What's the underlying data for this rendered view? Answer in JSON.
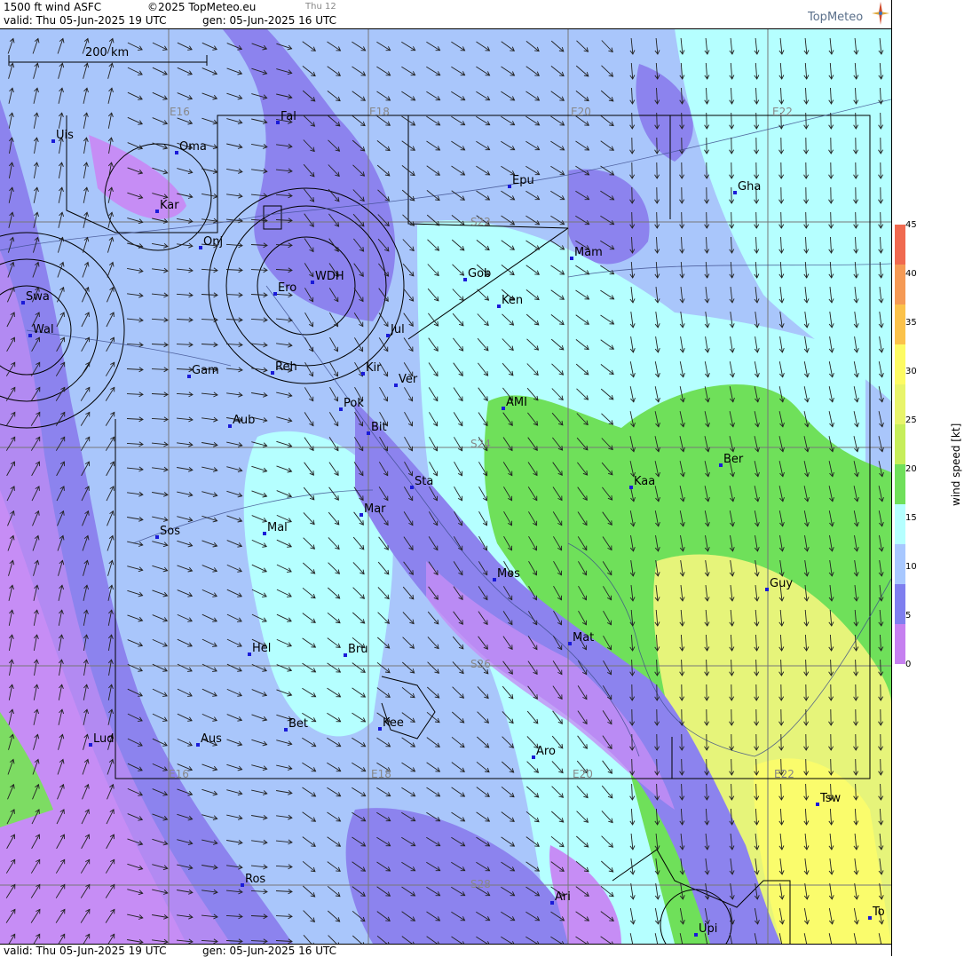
{
  "header": {
    "title": "1500 ft wind ASFC",
    "copyright": "©2025 TopMeteo.eu",
    "day_tab": "Thu 12",
    "valid": "valid:  Thu  05-Jun-2025  19 UTC",
    "generated": "gen:  05-Jun-2025 16 UTC",
    "logo": "TopMeteo"
  },
  "footer": {
    "valid": "valid:  Thu  05-Jun-2025  19 UTC",
    "generated": "gen:  05-Jun-2025 16 UTC"
  },
  "scale_bar": {
    "label": "200 km"
  },
  "legend": {
    "title": "wind  speed  [kt]",
    "ticks": [
      "45",
      "40",
      "35",
      "30",
      "25",
      "20",
      "15",
      "10",
      "5",
      "0"
    ],
    "colors": [
      "#f06a50",
      "#f59a55",
      "#fbc24a",
      "#fdfb63",
      "#e8f46a",
      "#c6ee5a",
      "#6fe05a",
      "#b5ffff",
      "#a8c8ff",
      "#7f7fef",
      "#c680f0"
    ]
  },
  "grid_labels": {
    "lon_top": [
      "E16",
      "E18",
      "E20",
      "E22"
    ],
    "lon_bottom": [
      "E16",
      "E18",
      "E20",
      "E22"
    ],
    "lat": [
      "S22",
      "S24",
      "S26",
      "S28"
    ]
  },
  "places": [
    {
      "name": "Uis",
      "label": "Uis"
    },
    {
      "name": "Oma",
      "label": "Oma"
    },
    {
      "name": "Fal",
      "label": "Fal"
    },
    {
      "name": "Kar",
      "label": "Kar"
    },
    {
      "name": "Onj",
      "label": "Onj"
    },
    {
      "name": "Epu",
      "label": "Epu"
    },
    {
      "name": "Gha",
      "label": "Gha"
    },
    {
      "name": "Mam",
      "label": "Mam"
    },
    {
      "name": "Gob",
      "label": "Gob"
    },
    {
      "name": "WDH",
      "label": "WDH"
    },
    {
      "name": "Ero",
      "label": "Ero"
    },
    {
      "name": "Ken",
      "label": "Ken"
    },
    {
      "name": "Swa",
      "label": "Swa"
    },
    {
      "name": "Wal",
      "label": "Wal"
    },
    {
      "name": "Jul",
      "label": "Jul"
    },
    {
      "name": "Gam",
      "label": "Gam"
    },
    {
      "name": "Reh",
      "label": "Reh"
    },
    {
      "name": "Kir",
      "label": "Kir"
    },
    {
      "name": "Ver",
      "label": "Ver"
    },
    {
      "name": "AMI",
      "label": "AMI"
    },
    {
      "name": "Pok",
      "label": "Pok"
    },
    {
      "name": "Aub",
      "label": "Aub"
    },
    {
      "name": "Bit",
      "label": "Bit"
    },
    {
      "name": "Ber",
      "label": "Ber"
    },
    {
      "name": "Sta",
      "label": "Sta"
    },
    {
      "name": "Kaa",
      "label": "Kaa"
    },
    {
      "name": "Mar",
      "label": "Mar"
    },
    {
      "name": "Sos",
      "label": "Sos"
    },
    {
      "name": "Mal",
      "label": "Mal"
    },
    {
      "name": "Mos",
      "label": "Mos"
    },
    {
      "name": "Guy",
      "label": "Guy"
    },
    {
      "name": "Mat",
      "label": "Mat"
    },
    {
      "name": "Hel",
      "label": "Hel"
    },
    {
      "name": "Bru",
      "label": "Bru"
    },
    {
      "name": "Bet",
      "label": "Bet"
    },
    {
      "name": "Kee",
      "label": "Kee"
    },
    {
      "name": "Lud",
      "label": "Lud"
    },
    {
      "name": "Aus",
      "label": "Aus"
    },
    {
      "name": "Aro",
      "label": "Aro"
    },
    {
      "name": "Tsw",
      "label": "Tsw"
    },
    {
      "name": "Ros",
      "label": "Ros"
    },
    {
      "name": "Ari",
      "label": "Ari"
    },
    {
      "name": "Upi",
      "label": "Upi"
    },
    {
      "name": "To",
      "label": "To"
    }
  ]
}
